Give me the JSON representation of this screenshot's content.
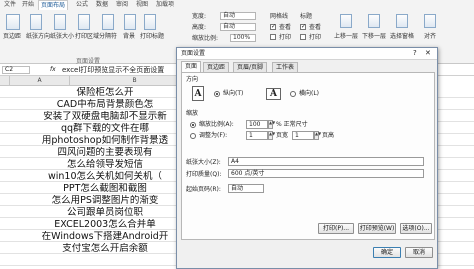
{
  "ribbon": {
    "tabs": [
      "文件",
      "开始",
      "页面布局",
      "公式",
      "数据",
      "审阅",
      "视图",
      "加载项"
    ],
    "tools": {
      "margins": "页边距",
      "orientation": "纸张方向",
      "size": "纸张大小",
      "print_area": "打印区域",
      "breaks": "分隔符",
      "background": "背景",
      "print_titles": "打印标题",
      "width_label": "宽度:",
      "width_value": "自动",
      "height_label": "高度:",
      "height_value": "自动",
      "scale_label": "缩放比例:",
      "scale_value": "100%",
      "gridlines": "网格线",
      "headings": "标题",
      "view": "查看",
      "print": "打印",
      "bring_forward": "上移一层",
      "send_backward": "下移一层",
      "selection_pane": "选择窗格",
      "align": "对齐"
    },
    "group_label": "页面设置"
  },
  "formula_bar": {
    "name_box": "C2",
    "fx": "fx",
    "content": "excel打印预览显示不全页面设置"
  },
  "sheet": {
    "col_a": "A",
    "col_b": "B",
    "rows": [
      "保险柜怎么开",
      "CAD中布局背景颜色怎",
      "安装了双硬盘电脑却不显示新",
      "qq群下载的文件在哪",
      "用photoshop如何制作背景透",
      "四风问题的主要表现有",
      "怎么给领导发短信",
      "win10怎么关机如何关机（",
      "PPT怎么截图和截图",
      "怎么用PS调整图片的渐变",
      "公司跟单员岗位职",
      "EXCEL2003怎么合并单",
      "在Windows下搭建Android开",
      "支付宝怎么开启余额"
    ]
  },
  "dialog": {
    "title": "页面设置",
    "help": "?",
    "close": "✕",
    "tabs": [
      "页面",
      "页边距",
      "页眉/页脚",
      "工作表"
    ],
    "orientation_label": "方向",
    "portrait": "纵向(T)",
    "landscape": "横向(L)",
    "scaling_label": "缩放",
    "adjust_to": "缩放比例(A):",
    "adjust_value": "100",
    "adjust_unit": "% 正常尺寸",
    "fit_to": "调整为(F):",
    "fit_wide_value": "1",
    "fit_wide_unit": "页宽",
    "fit_tall_value": "1",
    "fit_tall_unit": "页高",
    "paper_size_label": "纸张大小(Z):",
    "paper_size_value": "A4",
    "print_quality_label": "打印质量(Q):",
    "print_quality_value": "600 点/英寸",
    "first_page_label": "起始页码(R):",
    "first_page_value": "自动",
    "print_btn": "打印(P)...",
    "preview_btn": "打印预览(W)",
    "options_btn": "选项(O)...",
    "ok_btn": "确定",
    "cancel_btn": "取消",
    "portrait_glyph": "A",
    "landscape_glyph": "A"
  }
}
